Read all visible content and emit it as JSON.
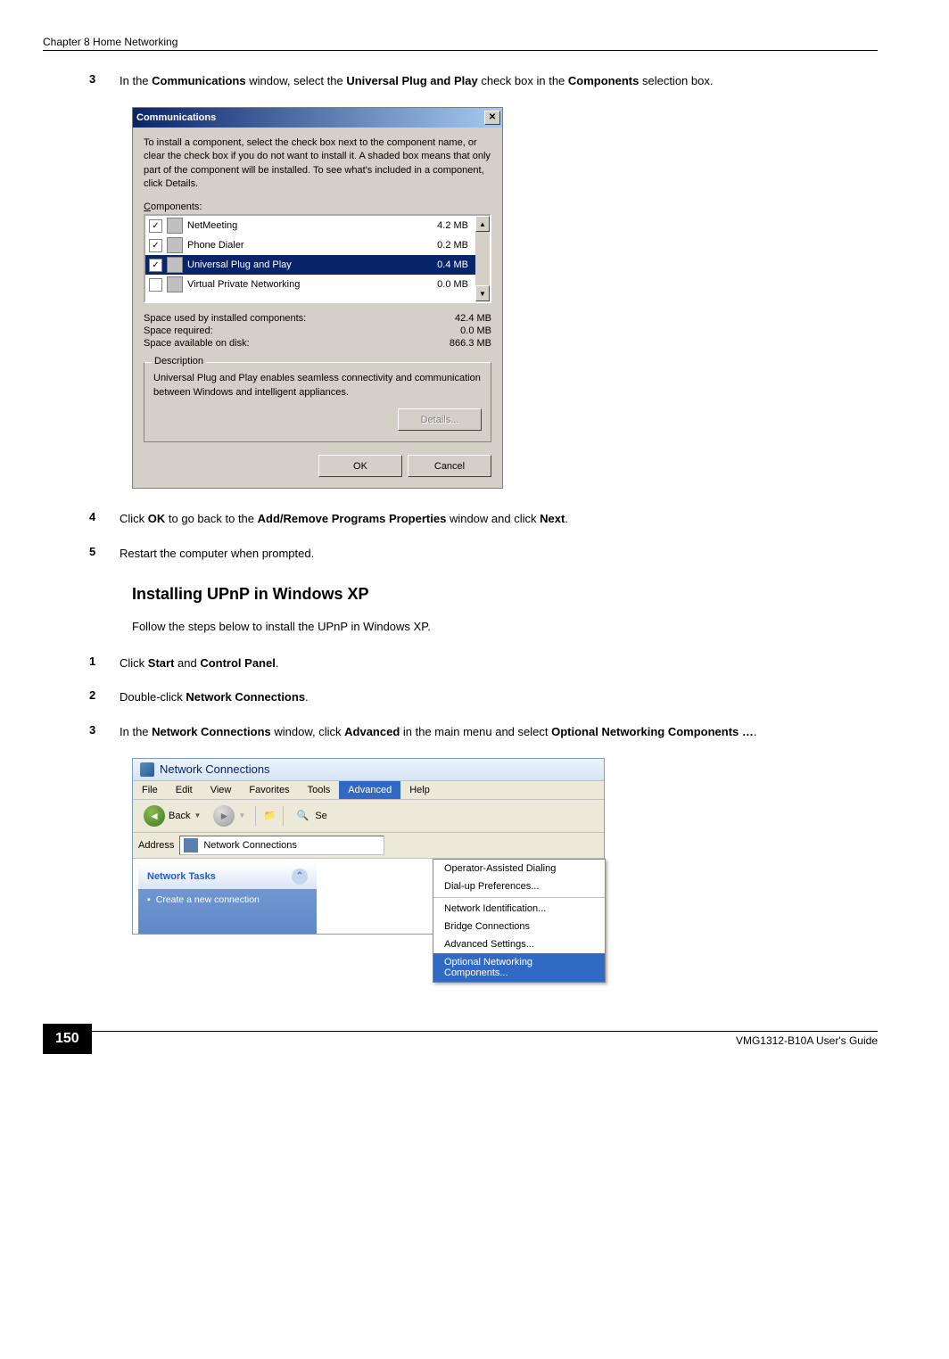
{
  "header": {
    "chapter": "Chapter 8 Home Networking"
  },
  "steps_a": [
    {
      "num": "3",
      "parts": [
        "In the ",
        "Communications",
        " window, select the ",
        "Universal Plug and Play",
        " check box in the ",
        "Components",
        " selection box."
      ]
    },
    {
      "num": "4",
      "parts": [
        "Click ",
        "OK",
        " to go back to the ",
        "Add/Remove Programs Properties",
        " window and click ",
        "Next",
        "."
      ]
    },
    {
      "num": "5",
      "parts": [
        "Restart the computer when prompted."
      ]
    }
  ],
  "comm_dialog": {
    "title": "Communications",
    "instruction": "To install a component, select the check box next to the component name, or clear the check box if you do not want to install it. A shaded box means that only part of the component will be installed. To see what's included in a component, click Details.",
    "label": "Components:",
    "rows": [
      {
        "checked": true,
        "name": "NetMeeting",
        "size": "4.2 MB"
      },
      {
        "checked": true,
        "name": "Phone Dialer",
        "size": "0.2 MB"
      },
      {
        "checked": true,
        "name": "Universal Plug and Play",
        "size": "0.4 MB",
        "selected": true
      },
      {
        "checked": false,
        "name": "Virtual Private Networking",
        "size": "0.0 MB"
      }
    ],
    "summary": [
      {
        "label": "Space used by installed components:",
        "value": "42.4 MB"
      },
      {
        "label": "Space required:",
        "value": "0.0 MB"
      },
      {
        "label": "Space available on disk:",
        "value": "866.3 MB"
      }
    ],
    "desc_label": "Description",
    "desc": "Universal Plug and Play enables seamless connectivity and communication between Windows and intelligent appliances.",
    "details_btn": "Details...",
    "ok": "OK",
    "cancel": "Cancel"
  },
  "section_title": "Installing UPnP in Windows XP",
  "section_intro": "Follow the steps below to install the UPnP in Windows XP.",
  "steps_b": [
    {
      "num": "1",
      "parts": [
        "Click ",
        "Start",
        " and ",
        "Control Panel",
        "."
      ]
    },
    {
      "num": "2",
      "parts": [
        "Double-click ",
        "Network Connections",
        "."
      ]
    },
    {
      "num": "3",
      "parts": [
        "In the ",
        "Network Connections",
        " window, click ",
        "Advanced",
        " in the main menu and select ",
        "Optional Networking Components …",
        "."
      ]
    }
  ],
  "netcon": {
    "title": "Network Connections",
    "menu": [
      "File",
      "Edit",
      "View",
      "Favorites",
      "Tools",
      "Advanced",
      "Help"
    ],
    "menu_active": "Advanced",
    "back": "Back",
    "search": "Se",
    "addr_label": "Address",
    "addr_value": "Network Connections",
    "task_header": "Network Tasks",
    "task_item": "Create a new connection",
    "dropdown": [
      "Operator-Assisted Dialing",
      "Dial-up Preferences...",
      "Network Identification...",
      "Bridge Connections",
      "Advanced Settings...",
      "Optional Networking Components..."
    ],
    "dropdown_hl": "Optional Networking Components..."
  },
  "footer": {
    "page": "150",
    "guide": "VMG1312-B10A User's Guide"
  }
}
